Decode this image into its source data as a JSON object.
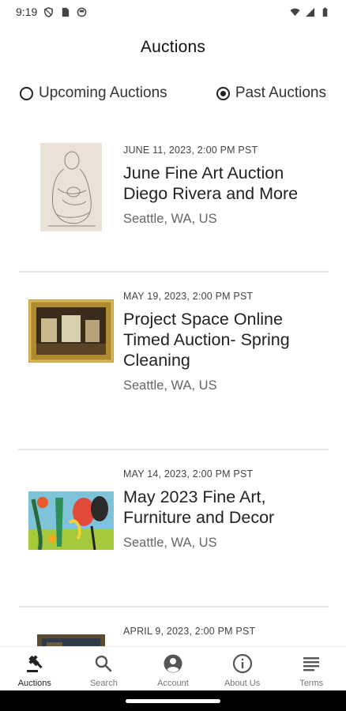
{
  "status_bar": {
    "time": "9:19"
  },
  "header": {
    "title": "Auctions"
  },
  "filters": {
    "upcoming_label": "Upcoming Auctions",
    "past_label": "Past Auctions",
    "selected": "past"
  },
  "auctions": [
    {
      "date": "JUNE 11, 2023, 2:00 PM PST",
      "title": "June Fine Art Auction Diego Rivera and More",
      "location": "Seattle, WA, US",
      "thumbnail": "sketch-artwork"
    },
    {
      "date": "MAY 19, 2023, 2:00 PM PST",
      "title": "Project Space Online Timed Auction- Spring Cleaning",
      "location": "Seattle, WA, US",
      "thumbnail": "framed-painting"
    },
    {
      "date": "MAY 14, 2023, 2:00 PM PST",
      "title": "May 2023 Fine Art, Furniture and Decor",
      "location": "Seattle, WA, US",
      "thumbnail": "colorful-abstract"
    },
    {
      "date": "APRIL 9, 2023, 2:00 PM PST",
      "title": "",
      "location": "",
      "thumbnail": "dark-framed-artwork"
    }
  ],
  "bottom_nav": [
    {
      "label": "Auctions",
      "icon": "gavel-icon",
      "active": true
    },
    {
      "label": "Search",
      "icon": "search-icon",
      "active": false
    },
    {
      "label": "Account",
      "icon": "account-icon",
      "active": false
    },
    {
      "label": "About Us",
      "icon": "info-icon",
      "active": false
    },
    {
      "label": "Terms",
      "icon": "menu-lines-icon",
      "active": false
    }
  ]
}
